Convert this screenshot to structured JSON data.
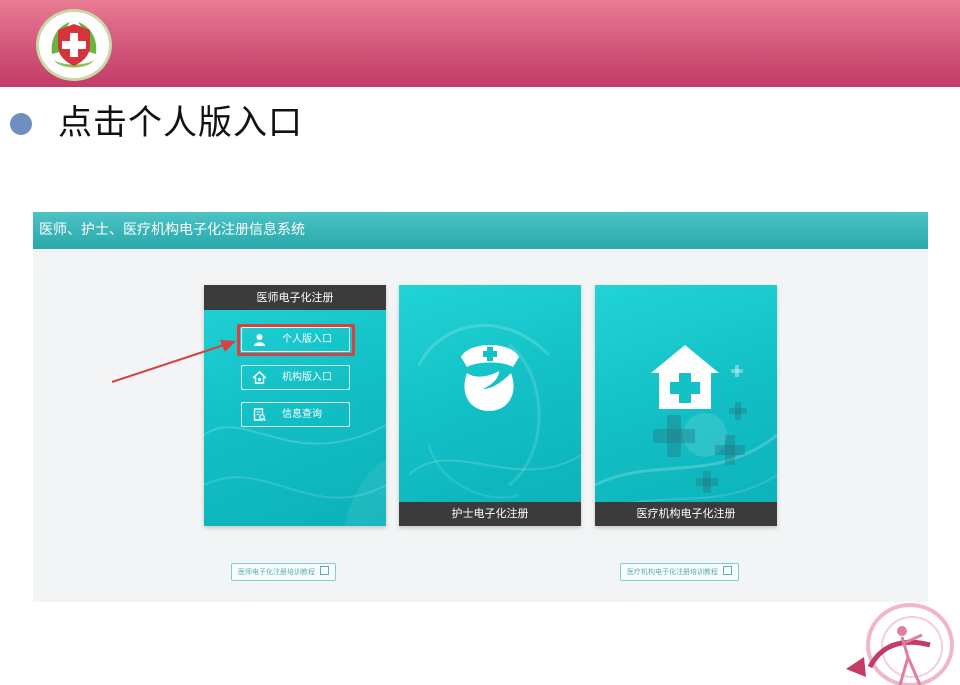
{
  "slide": {
    "title": "点击个人版入口"
  },
  "screenshot": {
    "system_title": "医师、护士、医疗机构电子化注册信息系统",
    "cards": {
      "doctor": {
        "title": "医师电子化注册",
        "buttons": {
          "personal": "个人版入口",
          "institution": "机构版入口",
          "query": "信息查询"
        }
      },
      "nurse": {
        "title": "护士电子化注册"
      },
      "institution": {
        "title": "医疗机构电子化注册"
      }
    },
    "links": {
      "doctor_tutorial": "医师电子化注册培训教程",
      "institution_tutorial": "医疗机构电子化注册培训教程"
    }
  },
  "colors": {
    "header_band": "#d3567a",
    "card_teal": "#13c1c7",
    "highlight_red": "#d9403f",
    "bullet_blue": "#6f8fc0"
  },
  "icons": {
    "logo": "medical-cross-leaf-logo",
    "personal": "user-icon",
    "institution": "house-icon",
    "query": "document-search-icon",
    "nurse": "nurse-cap-icon",
    "hospital": "house-cross-icon",
    "download": "download-icon"
  }
}
